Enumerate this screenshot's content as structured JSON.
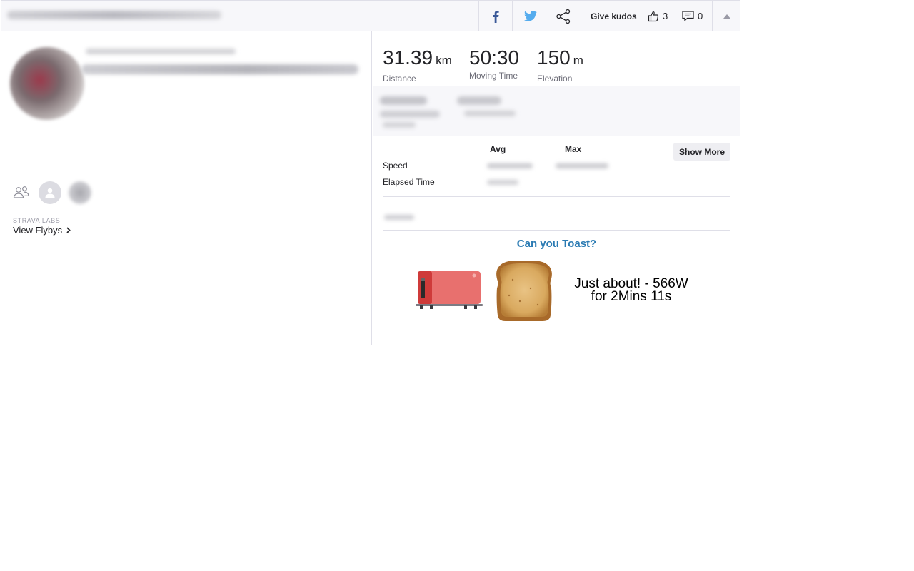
{
  "topbar": {
    "facebook_icon": "facebook-icon",
    "twitter_icon": "twitter-icon",
    "share_icon": "share-icon",
    "kudos_label": "Give kudos",
    "kudos_count": "3",
    "comment_count": "0"
  },
  "athlete": {
    "labs_label": "STRAVA LABS",
    "flybys_label": "View Flybys"
  },
  "stats": {
    "distance": {
      "value": "31.39",
      "unit": "km",
      "label": "Distance"
    },
    "moving_time": {
      "value": "50:30",
      "label": "Moving Time"
    },
    "elevation": {
      "value": "150",
      "unit": "m",
      "label": "Elevation"
    }
  },
  "more_stats": {
    "col_avg": "Avg",
    "col_max": "Max",
    "show_more": "Show More",
    "rows": [
      {
        "label": "Speed"
      },
      {
        "label": "Elapsed Time"
      }
    ]
  },
  "toast": {
    "title": "Can you Toast?",
    "result_line1": "Just about! - 566W",
    "result_line2": "for 2Mins 11s"
  },
  "colors": {
    "toast_title": "#2b7bb3",
    "facebook": "#3b5998",
    "twitter": "#55acee",
    "toaster_red": "#e8706e"
  }
}
